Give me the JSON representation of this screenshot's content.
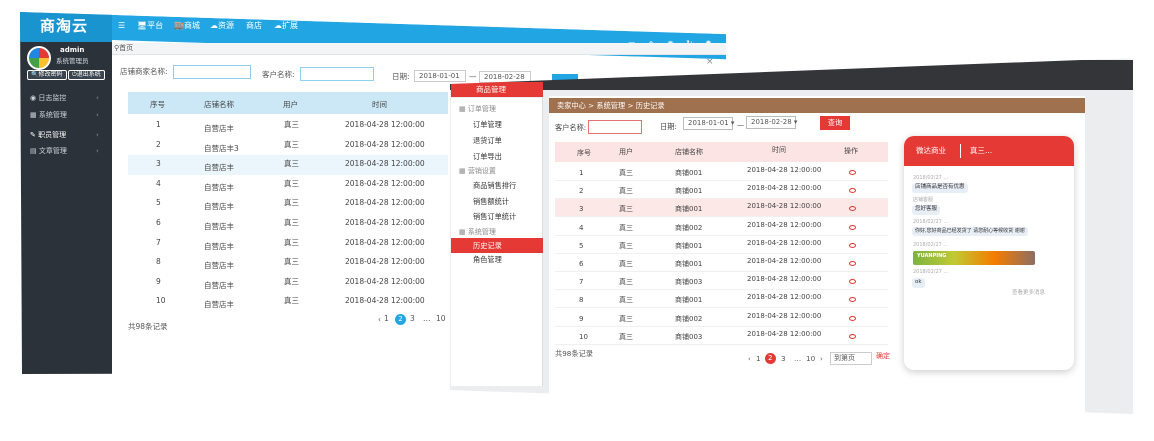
{
  "back": {
    "logo": "商淘云",
    "nav": [
      "☰",
      "🖥平台",
      "🏬商城",
      "☁资源",
      "商店",
      "☁扩展"
    ],
    "top_icons": [
      "monitor-icon",
      "shield-icon",
      "eye-icon",
      "refresh-icon",
      "gear-icon"
    ],
    "user": {
      "name": "admin",
      "role": "系统管理员",
      "btn_profile": "修改密码",
      "btn_logout": "退出系统"
    },
    "menu": [
      {
        "label": "日志监控",
        "icon": "◉"
      },
      {
        "label": "系统管理",
        "icon": "▦"
      },
      {
        "label": "职员管理",
        "icon": "✎"
      },
      {
        "label": "文章管理",
        "icon": "▤"
      }
    ],
    "breadcrumb": "首页",
    "filters": {
      "shop_label": "店铺商家名称:",
      "customer_label": "客户名称:",
      "date_label": "日期:",
      "date_from": "2018-01-01",
      "date_sep": "—",
      "date_to": "2018-02-28"
    },
    "table": {
      "headers": [
        "序号",
        "店铺名称",
        "用户",
        "时间"
      ],
      "rows": [
        [
          "1",
          "自营店丰",
          "真三",
          "2018-04-28 12:00:00"
        ],
        [
          "2",
          "自营店丰3",
          "真三",
          "2018-04-28 12:00:00"
        ],
        [
          "3",
          "自营店丰",
          "真三",
          "2018-04-28 12:00:00"
        ],
        [
          "4",
          "自营店丰",
          "真三",
          "2018-04-28 12:00:00"
        ],
        [
          "5",
          "自营店丰",
          "真三",
          "2018-04-28 12:00:00"
        ],
        [
          "6",
          "自营店丰",
          "真三",
          "2018-04-28 12:00:00"
        ],
        [
          "7",
          "自营店丰",
          "真三",
          "2018-04-28 12:00:00"
        ],
        [
          "8",
          "自营店丰",
          "真三",
          "2018-04-28 12:00:00"
        ],
        [
          "9",
          "自营店丰",
          "真三",
          "2018-04-28 12:00:00"
        ],
        [
          "10",
          "自营店丰",
          "真三",
          "2018-04-28 12:00:00"
        ]
      ]
    },
    "footer": "共98条记录",
    "pager": [
      "‹",
      "1",
      "2",
      "3",
      "…",
      "10"
    ]
  },
  "front": {
    "top_tab": "商品管理",
    "menu_groups": [
      {
        "title": "订单管理",
        "items": [
          "订单管理",
          "退货订单",
          "订单导出"
        ]
      },
      {
        "title": "营销设置",
        "items": [
          "商品销售排行",
          "销售额统计",
          "销售订单统计"
        ]
      },
      {
        "title": "系统管理",
        "items": [
          "历史记录",
          "角色管理"
        ]
      }
    ],
    "active_item": "历史记录",
    "breadcrumb": [
      "卖家中心",
      ">",
      "系统管理",
      ">",
      "历史记录"
    ],
    "filters": {
      "customer_label": "客户名称:",
      "date_label": "日期:",
      "date_from": "2018-01-01",
      "date_sep": "—",
      "date_to": "2018-02-28",
      "query": "查询"
    },
    "table": {
      "headers": [
        "序号",
        "用户",
        "店铺名称",
        "时间",
        "操作"
      ],
      "rows": [
        [
          "1",
          "真三",
          "商铺001",
          "2018-04-28 12:00:00"
        ],
        [
          "2",
          "真三",
          "商铺001",
          "2018-04-28 12:00:00"
        ],
        [
          "3",
          "真三",
          "商铺001",
          "2018-04-28 12:00:00"
        ],
        [
          "4",
          "真三",
          "商铺002",
          "2018-04-28 12:00:00"
        ],
        [
          "5",
          "真三",
          "商铺001",
          "2018-04-28 12:00:00"
        ],
        [
          "6",
          "真三",
          "商铺001",
          "2018-04-28 12:00:00"
        ],
        [
          "7",
          "真三",
          "商铺003",
          "2018-04-28 12:00:00"
        ],
        [
          "8",
          "真三",
          "商铺001",
          "2018-04-28 12:00:00"
        ],
        [
          "9",
          "真三",
          "商铺002",
          "2018-04-28 12:00:00"
        ],
        [
          "10",
          "真三",
          "商铺003",
          "2018-04-28 12:00:00"
        ]
      ]
    },
    "footer": "共98条记录",
    "pager": [
      "‹",
      "1",
      "2",
      "3",
      "…",
      "10",
      "›"
    ],
    "goto_label": "到第页",
    "goto_btn": "确定",
    "chat": {
      "shop": "微达商业",
      "user": "真三...",
      "messages": [
        {
          "ts": "2018/02/27 ...",
          "text": "店铺商品是否有优惠"
        },
        {
          "ts": "店铺客服",
          "text": "您好客服"
        },
        {
          "ts": "2018/02/27 ...",
          "text": "你好,您好商品已经发货了 请您耐心等候收货 谢谢"
        },
        {
          "ts": "2018/02/27 ...",
          "text": ""
        },
        {
          "ts": "2018/02/27 ...",
          "text": "ok"
        }
      ],
      "banner": "YUANPING",
      "more": "查看更多消息"
    }
  }
}
